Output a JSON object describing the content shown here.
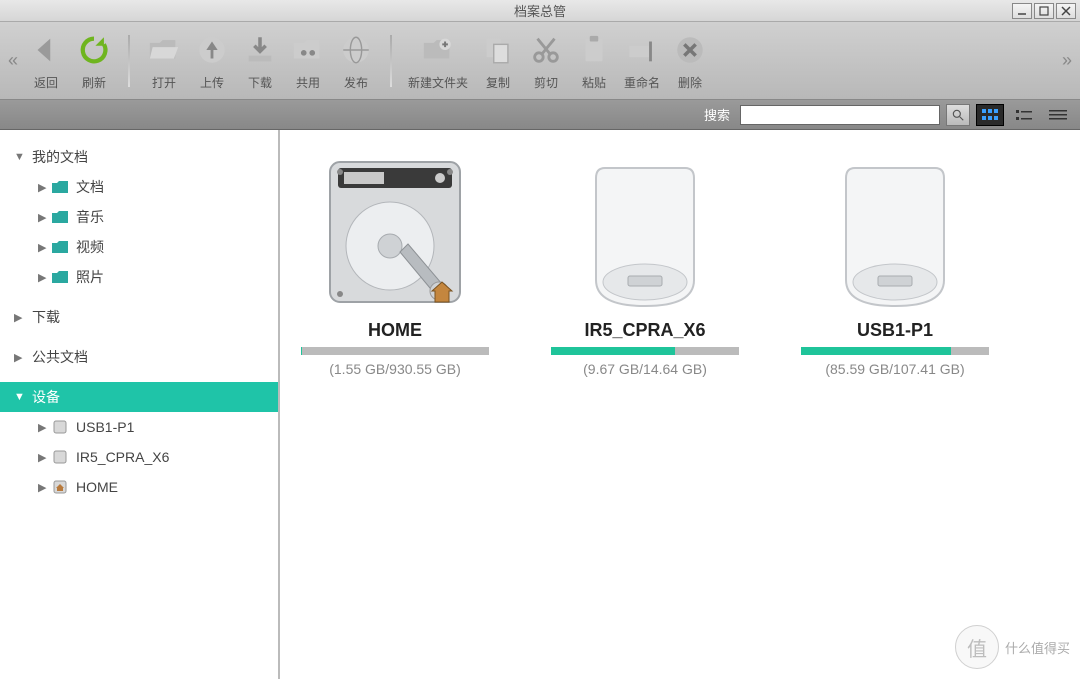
{
  "window": {
    "title": "档案总管"
  },
  "toolbar": {
    "back": "返回",
    "refresh": "刷新",
    "open": "打开",
    "upload": "上传",
    "download": "下载",
    "share": "共用",
    "publish": "发布",
    "newfolder": "新建文件夹",
    "copy": "复制",
    "cut": "剪切",
    "paste": "粘贴",
    "rename": "重命名",
    "delete": "删除"
  },
  "search": {
    "label": "搜索"
  },
  "sidebar": {
    "mydocs": {
      "label": "我的文档"
    },
    "docs": {
      "label": "文档"
    },
    "music": {
      "label": "音乐"
    },
    "video": {
      "label": "视频"
    },
    "photo": {
      "label": "照片"
    },
    "downloads": {
      "label": "下载"
    },
    "public": {
      "label": "公共文档"
    },
    "devices": {
      "label": "设备"
    },
    "dev1": {
      "label": "USB1-P1"
    },
    "dev2": {
      "label": "IR5_CPRA_X6"
    },
    "dev3": {
      "label": "HOME"
    }
  },
  "drives": {
    "d1": {
      "name": "HOME",
      "usage": "(1.55 GB/930.55 GB)",
      "fill": "0.2%"
    },
    "d2": {
      "name": "IR5_CPRA_X6",
      "usage": "(9.67 GB/14.64 GB)",
      "fill": "66%"
    },
    "d3": {
      "name": "USB1-P1",
      "usage": "(85.59 GB/107.41 GB)",
      "fill": "80%"
    }
  },
  "watermark": {
    "text": "什么值得买"
  }
}
